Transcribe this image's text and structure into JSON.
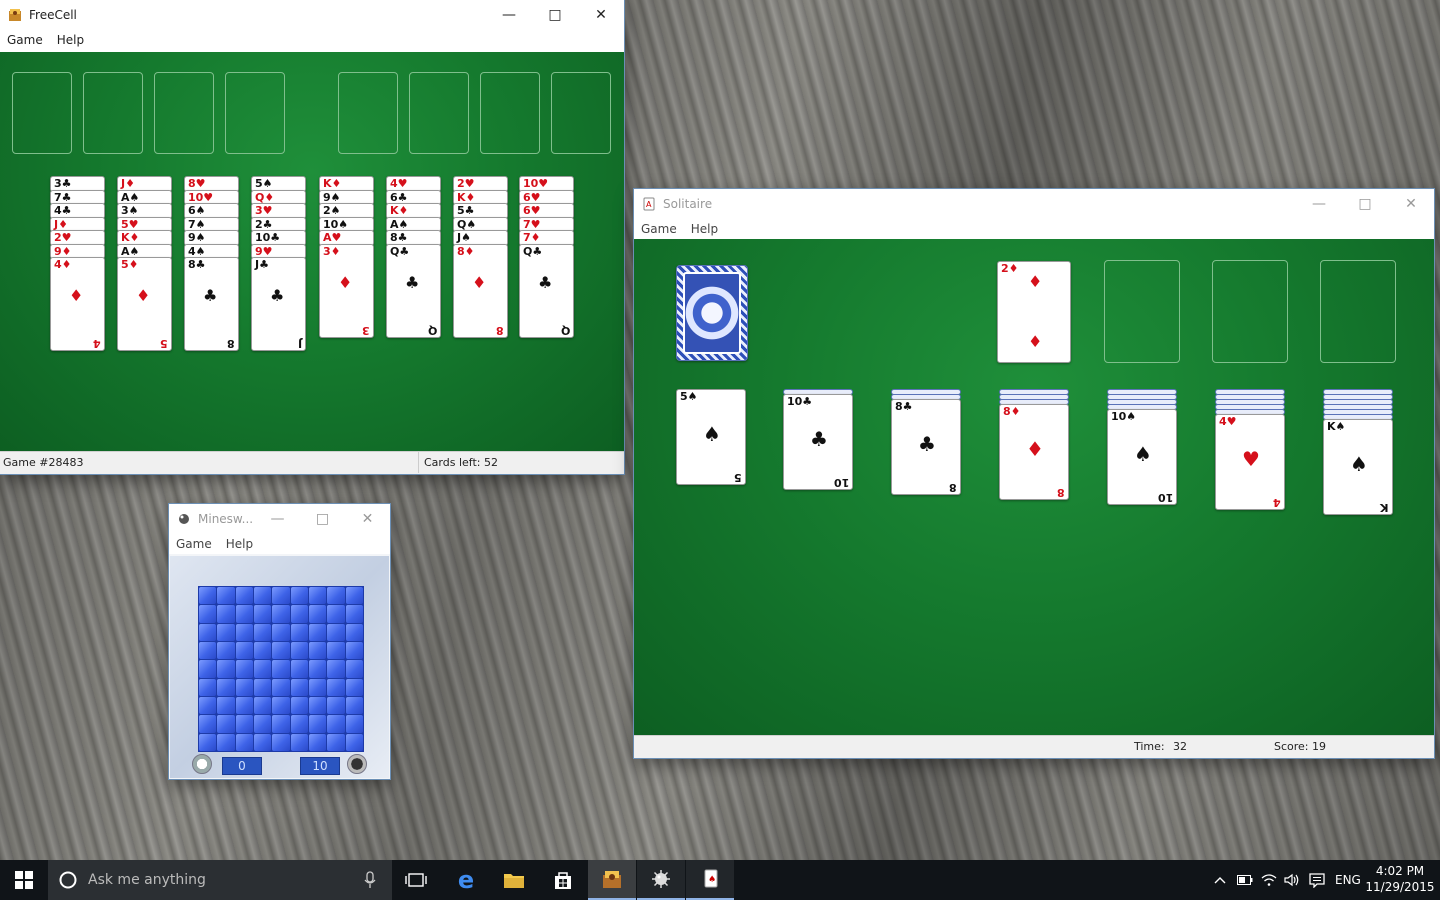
{
  "freecell": {
    "title": "FreeCell",
    "menu": [
      "Game",
      "Help"
    ],
    "status_game": "Game #28483",
    "status_cards": "Cards left: 52",
    "columns": [
      [
        "3♣",
        "7♣",
        "4♣",
        "J♦",
        "2♥",
        "9♦",
        "4♦"
      ],
      [
        "J♦",
        "A♠",
        "3♠",
        "5♥",
        "K♦",
        "A♠",
        "5♦"
      ],
      [
        "8♥",
        "10♥",
        "6♠",
        "7♠",
        "9♠",
        "4♠",
        "8♣"
      ],
      [
        "5♠",
        "Q♦",
        "3♥",
        "2♣",
        "10♣",
        "9♥",
        "J♣"
      ],
      [
        "K♦",
        "9♠",
        "2♠",
        "10♠",
        "A♥",
        "3♦"
      ],
      [
        "4♥",
        "6♣",
        "K♦",
        "A♠",
        "8♣",
        "Q♣"
      ],
      [
        "2♥",
        "K♦",
        "5♣",
        "Q♠",
        "J♠",
        "8♦"
      ],
      [
        "10♥",
        "6♥",
        "6♥",
        "7♥",
        "7♦",
        "Q♣"
      ]
    ]
  },
  "solitaire": {
    "title": "Solitaire",
    "menu": [
      "Game",
      "Help"
    ],
    "time_label": "Time:",
    "time_value": "32",
    "score_label": "Score: 19",
    "foundation_top": "2♦",
    "tableau": [
      {
        "rank": "5",
        "suit": "♠",
        "color": "black",
        "hidden": 0
      },
      {
        "rank": "10",
        "suit": "♣",
        "color": "black",
        "hidden": 1
      },
      {
        "rank": "8",
        "suit": "♣",
        "color": "black",
        "hidden": 2
      },
      {
        "rank": "8",
        "suit": "♦",
        "color": "red",
        "hidden": 3
      },
      {
        "rank": "10",
        "suit": "♠",
        "color": "black",
        "hidden": 4
      },
      {
        "rank": "4",
        "suit": "♥",
        "color": "red",
        "hidden": 5
      },
      {
        "rank": "K",
        "suit": "♠",
        "color": "black",
        "hidden": 6
      }
    ]
  },
  "minesweeper": {
    "title": "Minesw...",
    "menu": [
      "Game",
      "Help"
    ],
    "timer": "0",
    "mines": "10"
  },
  "taskbar": {
    "search_placeholder": "Ask me anything",
    "language": "ENG",
    "time": "4:02 PM",
    "date": "11/29/2015"
  }
}
